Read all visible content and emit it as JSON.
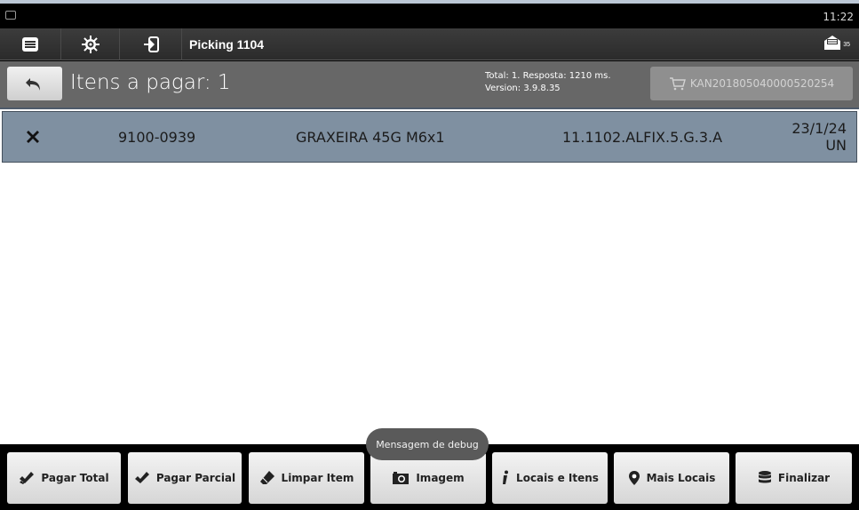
{
  "status_bar": {
    "time": "11:22"
  },
  "toolbar": {
    "title": "Picking 1104",
    "mail_count": "35"
  },
  "header": {
    "title": "Itens a pagar: 1",
    "info_line1": "Total: 1. Resposta: 1210 ms.",
    "info_line2": "Version: 3.9.8.35",
    "kanban_label": "KAN201805040000520254"
  },
  "items": [
    {
      "code": "9100-0939",
      "description": "GRAXEIRA 45G M6x1",
      "location": "11.1102.ALFIX.5.G.3.A",
      "date": "23/1/24",
      "unit": "UN"
    }
  ],
  "bottom_buttons": [
    {
      "label": "Pagar Total",
      "icon": "double-check-icon"
    },
    {
      "label": "Pagar Parcial",
      "icon": "check-icon"
    },
    {
      "label": "Limpar Item",
      "icon": "eraser-icon"
    },
    {
      "label": "Imagem",
      "icon": "camera-icon"
    },
    {
      "label": "Locais e Itens",
      "icon": "info-icon"
    },
    {
      "label": "Mais Locais",
      "icon": "map-marker-icon"
    },
    {
      "label": "Finalizar",
      "icon": "database-icon"
    }
  ],
  "toast": {
    "message": "Mensagem de debug"
  },
  "colors": {
    "toolbar": "#333333",
    "header": "#676767",
    "item_row": "#7f90a1",
    "button": "#e8e8e8"
  }
}
